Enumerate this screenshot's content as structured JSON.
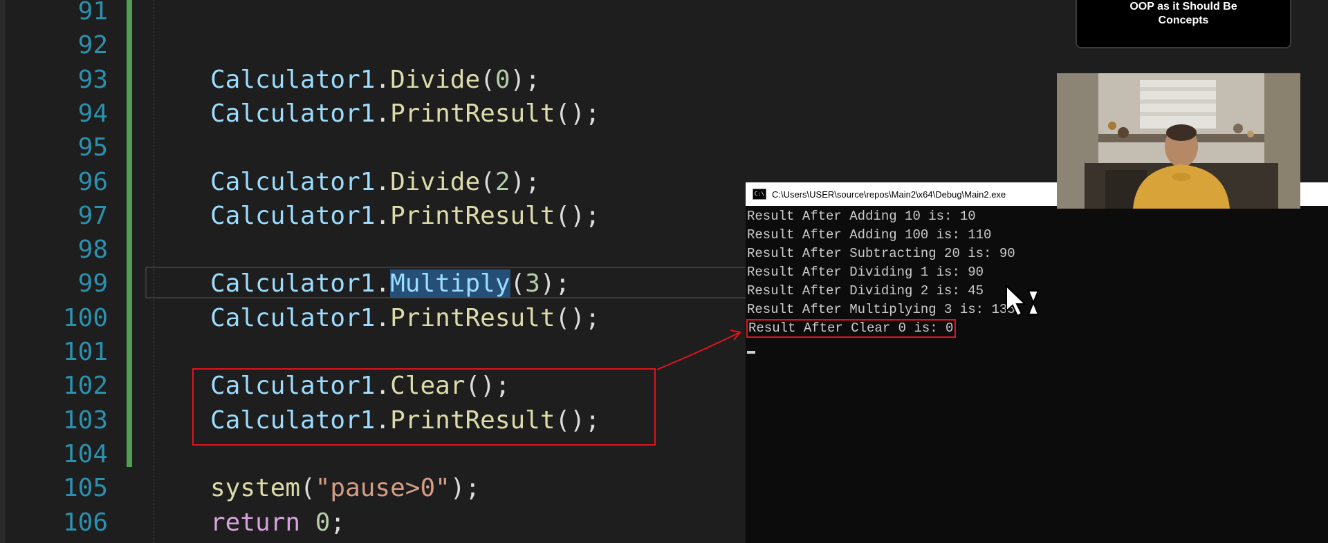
{
  "editor": {
    "lines": [
      {
        "num": "91",
        "code": []
      },
      {
        "num": "92",
        "code": []
      },
      {
        "num": "93",
        "code": [
          [
            "cls",
            "Calculator1"
          ],
          [
            "p",
            "."
          ],
          [
            "fn",
            "Divide"
          ],
          [
            "p",
            "("
          ],
          [
            "num",
            "0"
          ],
          [
            "p",
            ");"
          ]
        ]
      },
      {
        "num": "94",
        "code": [
          [
            "cls",
            "Calculator1"
          ],
          [
            "p",
            "."
          ],
          [
            "fn",
            "PrintResult"
          ],
          [
            "p",
            "();"
          ]
        ]
      },
      {
        "num": "95",
        "code": []
      },
      {
        "num": "96",
        "code": [
          [
            "cls",
            "Calculator1"
          ],
          [
            "p",
            "."
          ],
          [
            "fn",
            "Divide"
          ],
          [
            "p",
            "("
          ],
          [
            "num",
            "2"
          ],
          [
            "p",
            ");"
          ]
        ]
      },
      {
        "num": "97",
        "code": [
          [
            "cls",
            "Calculator1"
          ],
          [
            "p",
            "."
          ],
          [
            "fn",
            "PrintResult"
          ],
          [
            "p",
            "();"
          ]
        ]
      },
      {
        "num": "98",
        "code": []
      },
      {
        "num": "99",
        "code": [
          [
            "cls",
            "Calculator1"
          ],
          [
            "p",
            "."
          ],
          [
            "sel",
            "Multiply"
          ],
          [
            "p",
            "("
          ],
          [
            "num",
            "3"
          ],
          [
            "p",
            ");"
          ]
        ]
      },
      {
        "num": "100",
        "code": [
          [
            "cls",
            "Calculator1"
          ],
          [
            "p",
            "."
          ],
          [
            "fn",
            "PrintResult"
          ],
          [
            "p",
            "();"
          ]
        ]
      },
      {
        "num": "101",
        "code": []
      },
      {
        "num": "102",
        "code": [
          [
            "cls",
            "Calculator1"
          ],
          [
            "p",
            "."
          ],
          [
            "fn",
            "Clear"
          ],
          [
            "p",
            "();"
          ]
        ]
      },
      {
        "num": "103",
        "code": [
          [
            "cls",
            "Calculator1"
          ],
          [
            "p",
            "."
          ],
          [
            "fn",
            "PrintResult"
          ],
          [
            "p",
            "();"
          ]
        ]
      },
      {
        "num": "104",
        "code": []
      },
      {
        "num": "105",
        "code": [
          [
            "fn",
            "system"
          ],
          [
            "p",
            "("
          ],
          [
            "str",
            "\"pause>0\""
          ],
          [
            "p",
            ");"
          ]
        ]
      },
      {
        "num": "106",
        "code": [
          [
            "kw",
            "return"
          ],
          [
            "p",
            " "
          ],
          [
            "num",
            "0"
          ],
          [
            "p",
            ";"
          ]
        ]
      }
    ]
  },
  "console": {
    "icon_text": "C:\\",
    "title": "C:\\Users\\USER\\source\\repos\\Main2\\x64\\Debug\\Main2.exe",
    "lines": [
      "Result After Adding 10 is: 10",
      "Result After Adding 100 is: 110",
      "Result After Subtracting 20 is: 90",
      "Result After Dividing 1 is: 90",
      "Result After Dividing 2 is: 45",
      "Result After Multiplying 3 is: 135"
    ],
    "highlighted_line": "Result After Clear 0 is: 0"
  },
  "overlay": {
    "course_title_line1": "OOP as it Should Be",
    "course_title_line2": "Concepts"
  },
  "colors": {
    "background": "#1e1e1e",
    "line_number": "#2b91af",
    "class_name": "#9cdcfe",
    "function_name": "#dcdcaa",
    "number": "#b5cea8",
    "string": "#d69d85",
    "keyword": "#d8a0df",
    "selection": "#264f78",
    "annotation": "#e0141e",
    "change_bar": "#4f9e51"
  }
}
